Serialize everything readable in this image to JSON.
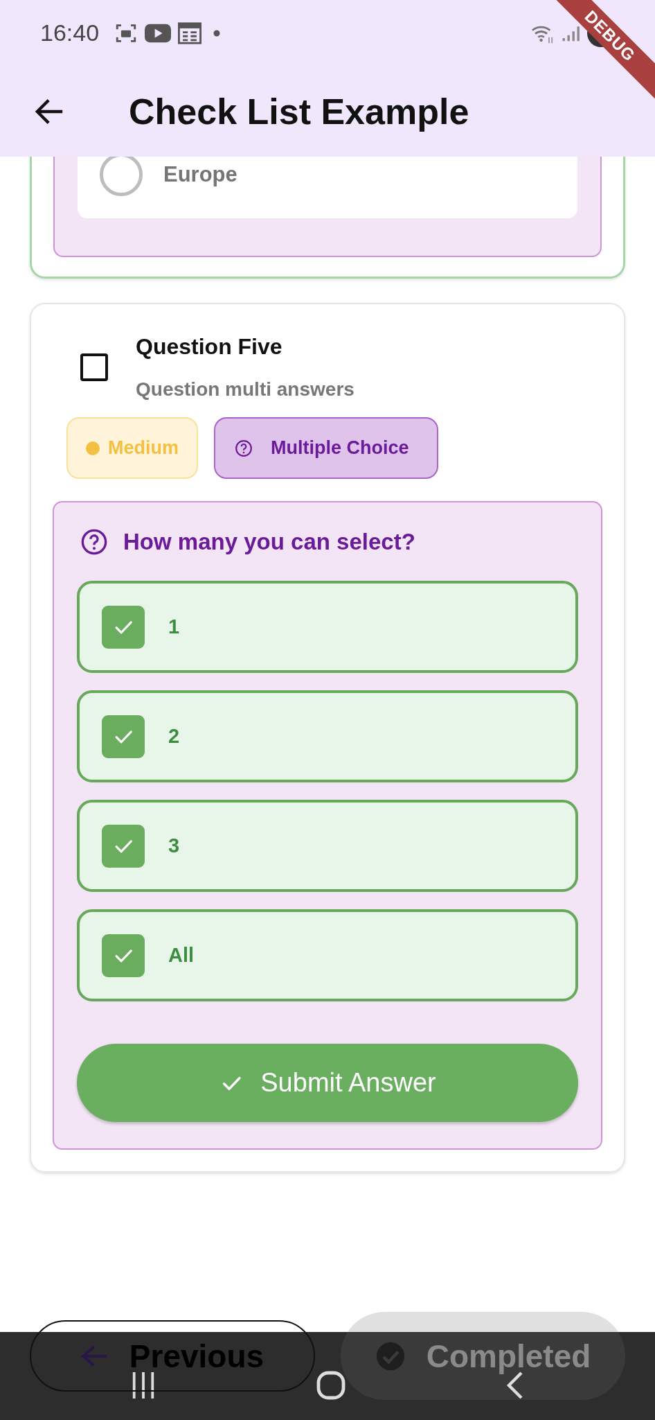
{
  "status_bar": {
    "time": "16:40"
  },
  "debug_banner": "DEBUG",
  "app_bar": {
    "title": "Check List Example"
  },
  "previous_card": {
    "answered": true,
    "options": [
      {
        "label": "Europe",
        "selected": false
      }
    ]
  },
  "question": {
    "title": "Question Five",
    "subtitle": "Question multi answers",
    "checked": false,
    "tags": [
      {
        "kind": "difficulty",
        "label": "Medium",
        "color": "#f4c041"
      },
      {
        "kind": "type",
        "label": "Multiple Choice"
      }
    ],
    "prompt": "How many you can select?",
    "options": [
      {
        "label": "1",
        "checked": true
      },
      {
        "label": "2",
        "checked": true
      },
      {
        "label": "3",
        "checked": true
      },
      {
        "label": "All",
        "checked": true
      }
    ],
    "submit_button": "Submit Answer"
  },
  "footer": {
    "previous_button": "Previous",
    "completed_button": {
      "label": "Completed",
      "disabled": true
    }
  }
}
